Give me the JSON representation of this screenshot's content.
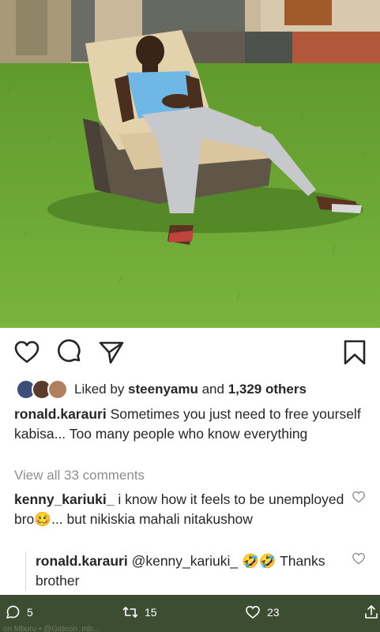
{
  "post": {
    "likes": {
      "prefix": "Liked by ",
      "user": "steenyamu",
      "middle": " and ",
      "count": "1,329 others"
    },
    "caption": {
      "username": "ronald.karauri",
      "text": " Sometimes you just need to free yourself kabisa... Too many people who know everything"
    },
    "view_all": "View all 33 comments",
    "comments": [
      {
        "username": "kenny_kariuki_",
        "text": " i know how it feels to be unemployed bro🥴... but nikiskia mahali nitakushow"
      },
      {
        "username": "ronald.karauri",
        "text": " @kenny_kariuki_ 🤣🤣 Thanks brother"
      }
    ],
    "icons": [
      "heart-icon",
      "comment-icon",
      "share-icon",
      "bookmark-icon"
    ]
  },
  "twitter_bar": {
    "replies": "5",
    "retweets": "15",
    "likes": "23",
    "faint_text": "on Mburu • @Gideon_mb..."
  },
  "colors": {
    "grass": "#6aa336",
    "twitter_bar": "#3c4d31",
    "muted_text": "#8e8e8e"
  }
}
